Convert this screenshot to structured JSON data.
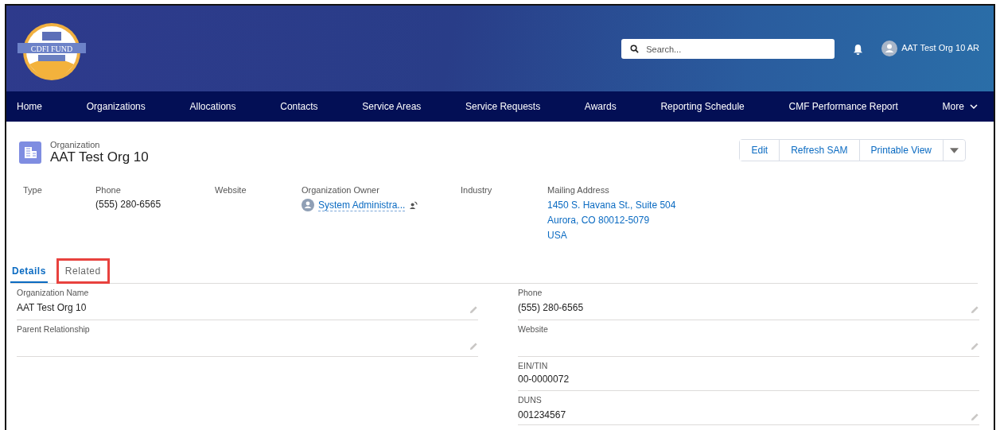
{
  "header": {
    "logo_text": "CDFI FUND",
    "search": {
      "placeholder": "Search..."
    },
    "user": "AAT Test Org 10 AR"
  },
  "nav": [
    {
      "label": "Home",
      "selected": false
    },
    {
      "label": "Organizations",
      "selected": false
    },
    {
      "label": "Allocations",
      "selected": false
    },
    {
      "label": "Contacts",
      "selected": false
    },
    {
      "label": "Service Areas",
      "selected": false
    },
    {
      "label": "Service Requests",
      "selected": false
    },
    {
      "label": "Awards",
      "selected": false
    },
    {
      "label": "Reporting Schedule",
      "selected": false
    },
    {
      "label": "CMF Performance Report",
      "selected": false
    },
    {
      "label": "More",
      "kind": "menu",
      "selected": false
    }
  ],
  "record": {
    "object": "Organization",
    "title": "AAT Test Org 10"
  },
  "actions": [
    "Edit",
    "Refresh SAM",
    "Printable View"
  ],
  "highlights": [
    {
      "label": "Type",
      "kind": "text"
    },
    {
      "label": "Phone",
      "kind": "text",
      "lines": [
        "(555) 280-6565"
      ]
    },
    {
      "label": "Website",
      "kind": "text"
    },
    {
      "label": "Organization Owner",
      "kind": "user",
      "lines": [
        "System Administra..."
      ]
    },
    {
      "label": "Industry",
      "kind": "text"
    },
    {
      "label": "Mailing Address",
      "kind": "link",
      "lines": [
        "1450 S. Havana St., Suite 504",
        "Aurora, CO 80012-5079",
        "USA"
      ]
    }
  ],
  "tabs": [
    {
      "label": "Details",
      "selected": true,
      "highlighted": false
    },
    {
      "label": "Related",
      "selected": false,
      "highlighted": true
    }
  ],
  "fields_left": [
    {
      "label": "Organization Name",
      "value": "AAT Test Org 10",
      "editable": true
    },
    {
      "label": "Parent Relationship",
      "editable": true
    }
  ],
  "fields_right": [
    {
      "label": "Phone",
      "value": "(555) 280-6565",
      "editable": true
    },
    {
      "label": "Website",
      "editable": true
    },
    {
      "label": "EIN/TIN",
      "value": "00-0000072",
      "editable": false
    },
    {
      "label": "DUNS",
      "value": "001234567",
      "editable": true
    }
  ]
}
